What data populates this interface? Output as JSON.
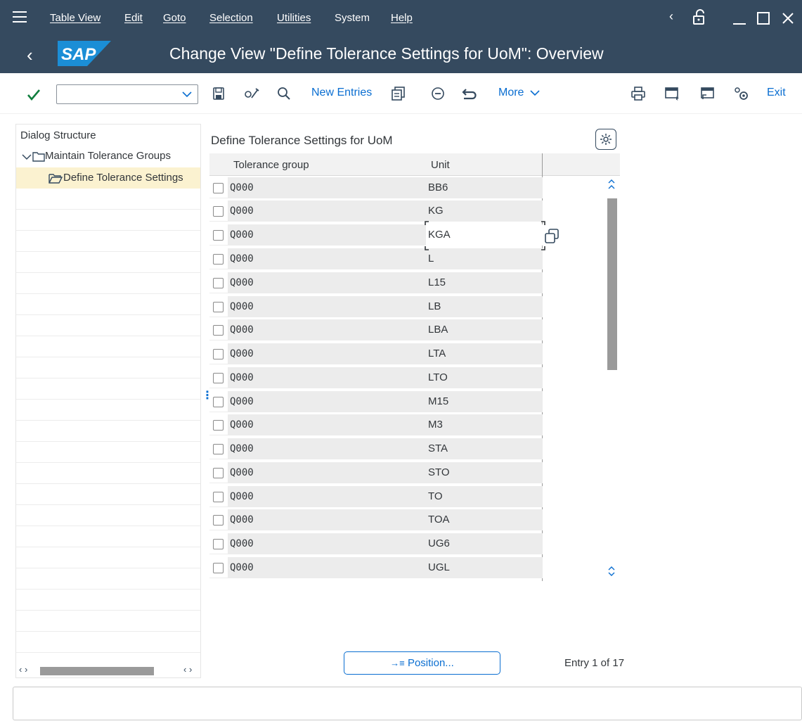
{
  "menu": {
    "items": [
      "Table View",
      "Edit",
      "Goto",
      "Selection",
      "Utilities",
      "System",
      "Help"
    ]
  },
  "window": {
    "title": "Change View \"Define Tolerance Settings for UoM\": Overview",
    "logo_text": "SAP"
  },
  "toolbar": {
    "new_entries_label": "New Entries",
    "more_label": "More",
    "exit_label": "Exit",
    "okcode_value": ""
  },
  "dialog_structure": {
    "header": "Dialog Structure",
    "nodes": [
      {
        "label": "Maintain Tolerance Groups",
        "level": 0,
        "selected": false
      },
      {
        "label": "Define Tolerance Settings",
        "level": 1,
        "selected": true
      }
    ]
  },
  "table": {
    "title": "Define Tolerance Settings for UoM",
    "columns": [
      "Tolerance group",
      "Unit"
    ],
    "rows": [
      {
        "tolerance_group": "Q000",
        "unit": "BB6"
      },
      {
        "tolerance_group": "Q000",
        "unit": "KG"
      },
      {
        "tolerance_group": "Q000",
        "unit": "KGA"
      },
      {
        "tolerance_group": "Q000",
        "unit": "L"
      },
      {
        "tolerance_group": "Q000",
        "unit": "L15"
      },
      {
        "tolerance_group": "Q000",
        "unit": "LB"
      },
      {
        "tolerance_group": "Q000",
        "unit": "LBA"
      },
      {
        "tolerance_group": "Q000",
        "unit": "LTA"
      },
      {
        "tolerance_group": "Q000",
        "unit": "LTO"
      },
      {
        "tolerance_group": "Q000",
        "unit": "M15"
      },
      {
        "tolerance_group": "Q000",
        "unit": "M3"
      },
      {
        "tolerance_group": "Q000",
        "unit": "STA"
      },
      {
        "tolerance_group": "Q000",
        "unit": "STO"
      },
      {
        "tolerance_group": "Q000",
        "unit": "TO"
      },
      {
        "tolerance_group": "Q000",
        "unit": "TOA"
      },
      {
        "tolerance_group": "Q000",
        "unit": "UG6"
      },
      {
        "tolerance_group": "Q000",
        "unit": "UGL"
      }
    ]
  },
  "footer": {
    "position_label": "Position...",
    "entry_text": "Entry 1 of 17"
  },
  "colors": {
    "shell": "#354a5f",
    "accent": "#0a6ed1",
    "selected_node": "#fbf2d0",
    "ok_green": "#107e3e"
  }
}
